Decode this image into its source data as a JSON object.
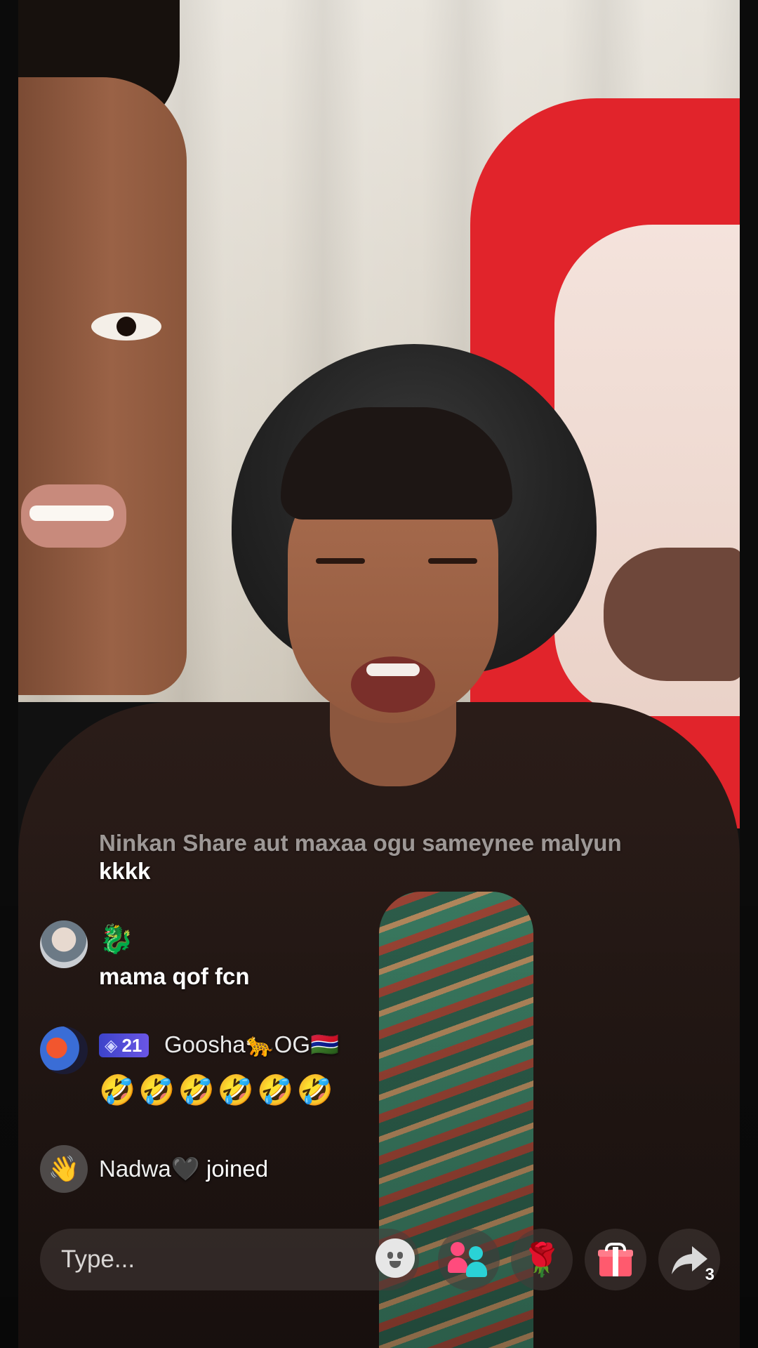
{
  "chat": {
    "messages": [
      {
        "text": "Ninkan Share aut maxaa ogu sameynee malyun",
        "text_cont": "kkkk"
      },
      {
        "badge_icon": "dragon-emoji",
        "badge_emoji": "🐉",
        "text": "mama qof fcn"
      },
      {
        "level": "21",
        "username": "Goosha🐆OG🇬🇲",
        "text": "🤣🤣🤣🤣🤣🤣"
      }
    ],
    "join": {
      "username": "Nadwa🖤",
      "verb": "joined"
    }
  },
  "bottom_bar": {
    "input_placeholder": "Type...",
    "share_count": "3",
    "rose_emoji": "🌹"
  }
}
